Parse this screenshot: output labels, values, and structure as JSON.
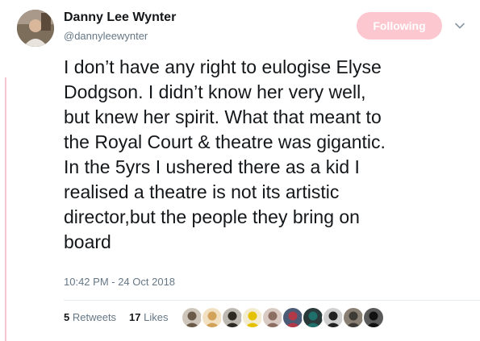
{
  "author": {
    "name": "Danny Lee Wynter",
    "handle": "@dannyleewynter"
  },
  "follow_button": {
    "label": "Following"
  },
  "tweet": {
    "text": "I don’t have any right to eulogise Elyse\nDodgson. I didn’t know her very well,\nbut knew her spirit. What that meant to\nthe Royal Court & theatre was gigantic.\nIn the 5yrs I ushered there as a kid I\nrealised a theatre is not its artistic\ndirector,but the people they bring on\nboard",
    "timestamp": "10:42 PM - 24 Oct 2018"
  },
  "stats": {
    "retweets_count": "5",
    "retweets_label": "Retweets",
    "likes_count": "17",
    "likes_label": "Likes"
  },
  "colors": {
    "accent_pink": "#fcc7cf",
    "left_rule": "#f7c6cf",
    "secondary_text": "#657786",
    "primary_text": "#14171a"
  },
  "icons": {
    "chevron": "chevron-down-icon"
  },
  "liker_avatars": [
    {
      "fg": "#6b5a4a",
      "bg": "#cfc6bb"
    },
    {
      "fg": "#d2a25b",
      "bg": "#f2e0c2"
    },
    {
      "fg": "#2d2a26",
      "bg": "#bdb8b1"
    },
    {
      "fg": "#e5c200",
      "bg": "#f3ecd0"
    },
    {
      "fg": "#8d6e63",
      "bg": "#d9cbc4"
    },
    {
      "fg": "#b23a48",
      "bg": "#4c5b76"
    },
    {
      "fg": "#1f6f6b",
      "bg": "#2a3a3a"
    },
    {
      "fg": "#222222",
      "bg": "#cfcfcf"
    },
    {
      "fg": "#3e3a35",
      "bg": "#8a7f73"
    },
    {
      "fg": "#111111",
      "bg": "#5a5a5a"
    }
  ]
}
